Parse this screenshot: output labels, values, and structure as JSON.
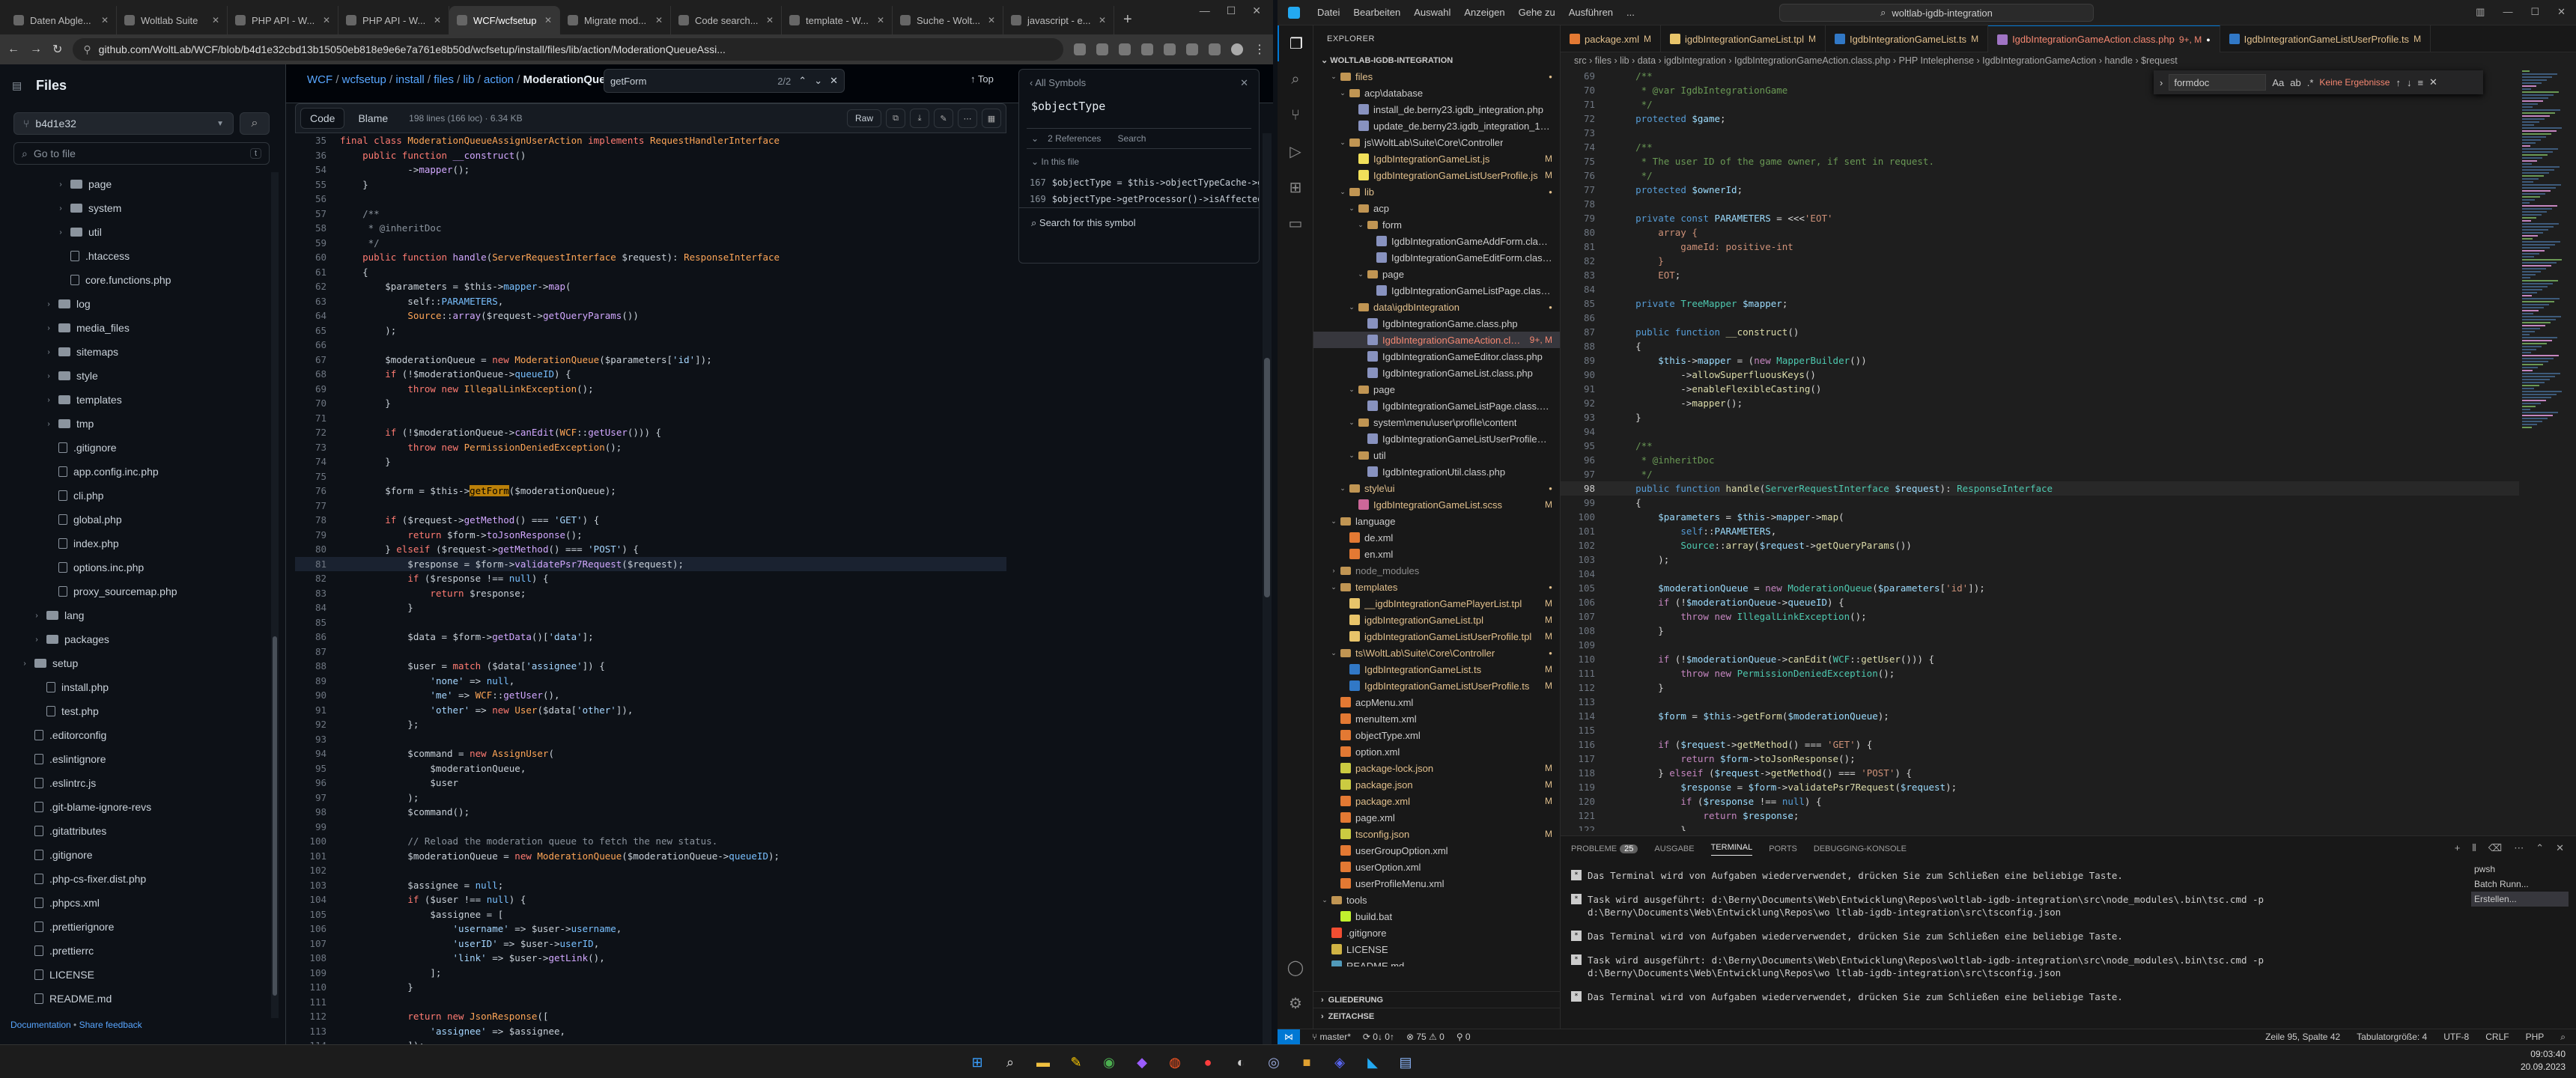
{
  "browser": {
    "tabs": [
      {
        "label": "Daten Abgle..."
      },
      {
        "label": "Woltlab Suite"
      },
      {
        "label": "PHP API - W..."
      },
      {
        "label": "PHP API - W..."
      },
      {
        "label": "WCF/wcfsetup"
      },
      {
        "label": "Migrate mod..."
      },
      {
        "label": "Code search..."
      },
      {
        "label": "template - W..."
      },
      {
        "label": "Suche - Wolt..."
      },
      {
        "label": "javascript - e..."
      }
    ],
    "url": "github.com/WoltLab/WCF/blob/b4d1e32cbd13b15050eb818e9e6e7a761e8b50d/wcfsetup/install/files/lib/action/ModerationQueueAssi..."
  },
  "github": {
    "files_title": "Files",
    "branch": "b4d1e32",
    "goto_placeholder": "Go to file",
    "goto_kbd": "t",
    "tree": [
      {
        "label": "page",
        "type": "folder",
        "depth": 2
      },
      {
        "label": "system",
        "type": "folder",
        "depth": 2
      },
      {
        "label": "util",
        "type": "folder",
        "depth": 2
      },
      {
        "label": ".htaccess",
        "type": "file",
        "depth": 2
      },
      {
        "label": "core.functions.php",
        "type": "file",
        "depth": 2
      },
      {
        "label": "log",
        "type": "folder",
        "depth": 1
      },
      {
        "label": "media_files",
        "type": "folder",
        "depth": 1
      },
      {
        "label": "sitemaps",
        "type": "folder",
        "depth": 1
      },
      {
        "label": "style",
        "type": "folder",
        "depth": 1
      },
      {
        "label": "templates",
        "type": "folder",
        "depth": 1
      },
      {
        "label": "tmp",
        "type": "folder",
        "depth": 1
      },
      {
        "label": ".gitignore",
        "type": "file",
        "depth": 1
      },
      {
        "label": "app.config.inc.php",
        "type": "file",
        "depth": 1
      },
      {
        "label": "cli.php",
        "type": "file",
        "depth": 1
      },
      {
        "label": "global.php",
        "type": "file",
        "depth": 1
      },
      {
        "label": "index.php",
        "type": "file",
        "depth": 1
      },
      {
        "label": "options.inc.php",
        "type": "file",
        "depth": 1
      },
      {
        "label": "proxy_sourcemap.php",
        "type": "file",
        "depth": 1
      },
      {
        "label": "lang",
        "type": "folder",
        "depth": 0
      },
      {
        "label": "packages",
        "type": "folder",
        "depth": 0
      },
      {
        "label": "setup",
        "type": "folder",
        "depth": -1
      },
      {
        "label": "install.php",
        "type": "file",
        "depth": 0
      },
      {
        "label": "test.php",
        "type": "file",
        "depth": 0
      },
      {
        "label": ".editorconfig",
        "type": "file",
        "depth": -1
      },
      {
        "label": ".eslintignore",
        "type": "file",
        "depth": -1
      },
      {
        "label": ".eslintrc.js",
        "type": "file",
        "depth": -1
      },
      {
        "label": ".git-blame-ignore-revs",
        "type": "file",
        "depth": -1
      },
      {
        "label": ".gitattributes",
        "type": "file",
        "depth": -1
      },
      {
        "label": ".gitignore",
        "type": "file",
        "depth": -1
      },
      {
        "label": ".php-cs-fixer.dist.php",
        "type": "file",
        "depth": -1
      },
      {
        "label": ".phpcs.xml",
        "type": "file",
        "depth": -1
      },
      {
        "label": ".prettierignore",
        "type": "file",
        "depth": -1
      },
      {
        "label": ".prettierrc",
        "type": "file",
        "depth": -1
      },
      {
        "label": "LICENSE",
        "type": "file",
        "depth": -1
      },
      {
        "label": "README.md",
        "type": "file",
        "depth": -1
      }
    ],
    "footer_doc": "Documentation",
    "footer_sep": " • ",
    "footer_feedback": "Share feedback",
    "breadcrumb": {
      "parts": [
        "WCF",
        "wcfsetup",
        "install",
        "files",
        "lib",
        "action"
      ],
      "current": "ModerationQueue..."
    },
    "find": {
      "value": "getForm",
      "count": "2/2"
    },
    "top_label": "Top",
    "code_tab": "Code",
    "blame_tab": "Blame",
    "meta": "198 lines (166 loc) · 6.34 KB",
    "raw_label": "Raw",
    "symbols": {
      "header": "All Symbols",
      "name": "$objectType",
      "refs_label": "2 References",
      "refs_search": "Search",
      "in_file": "In this file",
      "refs": [
        {
          "line": "167",
          "text": "$objectType = $this->objectTypeCache->get"
        },
        {
          "line": "169",
          "text": "$objectType->getProcessor()->isAffectedU"
        }
      ],
      "search_symbol": "Search for this symbol"
    }
  },
  "vscode": {
    "menu": [
      "Datei",
      "Bearbeiten",
      "Auswahl",
      "Anzeigen",
      "Gehe zu",
      "Ausführen",
      "..."
    ],
    "search": "woltlab-igdb-integration",
    "explorer_title": "EXPLORER",
    "root": "WOLTLAB-IGDB-INTEGRATION",
    "tree": [
      {
        "label": "files",
        "indent": 1,
        "chev": "v",
        "ic": "folder",
        "state": "",
        "cls": "m"
      },
      {
        "label": "acp\\database",
        "indent": 2,
        "chev": "v",
        "ic": "folder",
        "state": "",
        "cls": ""
      },
      {
        "label": "install_de.berny23.igdb_integration.php",
        "indent": 3,
        "chev": "",
        "ic": "php",
        "state": "",
        "cls": ""
      },
      {
        "label": "update_de.berny23.igdb_integration_1.2.2.php",
        "indent": 3,
        "chev": "",
        "ic": "php",
        "state": "",
        "cls": ""
      },
      {
        "label": "js\\WoltLab\\Suite\\Core\\Controller",
        "indent": 2,
        "chev": "v",
        "ic": "folder",
        "state": "",
        "cls": ""
      },
      {
        "label": "IgdbIntegrationGameList.js",
        "indent": 3,
        "chev": "",
        "ic": "js",
        "state": "M",
        "cls": "m"
      },
      {
        "label": "IgdbIntegrationGameListUserProfile.js",
        "indent": 3,
        "chev": "",
        "ic": "js",
        "state": "M",
        "cls": "m"
      },
      {
        "label": "lib",
        "indent": 2,
        "chev": "v",
        "ic": "folder",
        "state": "",
        "cls": "m"
      },
      {
        "label": "acp",
        "indent": 3,
        "chev": "v",
        "ic": "folder",
        "state": "",
        "cls": ""
      },
      {
        "label": "form",
        "indent": 4,
        "chev": "v",
        "ic": "folder",
        "state": "",
        "cls": ""
      },
      {
        "label": "IgdbIntegrationGameAddForm.class.php",
        "indent": 5,
        "chev": "",
        "ic": "php",
        "state": "",
        "cls": ""
      },
      {
        "label": "IgdbIntegrationGameEditForm.class.php",
        "indent": 5,
        "chev": "",
        "ic": "php",
        "state": "",
        "cls": ""
      },
      {
        "label": "page",
        "indent": 4,
        "chev": "v",
        "ic": "folder",
        "state": "",
        "cls": ""
      },
      {
        "label": "IgdbIntegrationGameListPage.class.php",
        "indent": 5,
        "chev": "",
        "ic": "php",
        "state": "",
        "cls": ""
      },
      {
        "label": "data\\igdbIntegration",
        "indent": 3,
        "chev": "v",
        "ic": "folder",
        "state": "",
        "cls": "m"
      },
      {
        "label": "IgdbIntegrationGame.class.php",
        "indent": 4,
        "chev": "",
        "ic": "php",
        "state": "",
        "cls": ""
      },
      {
        "label": "IgdbIntegrationGameAction.class.php",
        "indent": 4,
        "chev": "",
        "ic": "php",
        "state": "9+, M",
        "cls": "err",
        "sel": true
      },
      {
        "label": "IgdbIntegrationGameEditor.class.php",
        "indent": 4,
        "chev": "",
        "ic": "php",
        "state": "",
        "cls": ""
      },
      {
        "label": "IgdbIntegrationGameList.class.php",
        "indent": 4,
        "chev": "",
        "ic": "php",
        "state": "",
        "cls": ""
      },
      {
        "label": "page",
        "indent": 3,
        "chev": "v",
        "ic": "folder",
        "state": "",
        "cls": ""
      },
      {
        "label": "IgdbIntegrationGameListPage.class.php",
        "indent": 4,
        "chev": "",
        "ic": "php",
        "state": "",
        "cls": ""
      },
      {
        "label": "system\\menu\\user\\profile\\content",
        "indent": 3,
        "chev": "v",
        "ic": "folder",
        "state": "",
        "cls": ""
      },
      {
        "label": "IgdbIntegrationGameListUserProfileMenuC...",
        "indent": 4,
        "chev": "",
        "ic": "php",
        "state": "",
        "cls": ""
      },
      {
        "label": "util",
        "indent": 3,
        "chev": "v",
        "ic": "folder",
        "state": "",
        "cls": ""
      },
      {
        "label": "IgdbIntegrationUtil.class.php",
        "indent": 4,
        "chev": "",
        "ic": "php",
        "state": "",
        "cls": ""
      },
      {
        "label": "style\\ui",
        "indent": 2,
        "chev": "v",
        "ic": "folder",
        "state": "",
        "cls": "m"
      },
      {
        "label": "IgdbIntegrationGameList.scss",
        "indent": 3,
        "chev": "",
        "ic": "scss",
        "state": "M",
        "cls": "m"
      },
      {
        "label": "language",
        "indent": 1,
        "chev": "v",
        "ic": "folder",
        "state": "",
        "cls": ""
      },
      {
        "label": "de.xml",
        "indent": 2,
        "chev": "",
        "ic": "xml",
        "state": "",
        "cls": ""
      },
      {
        "label": "en.xml",
        "indent": 2,
        "chev": "",
        "ic": "xml",
        "state": "",
        "cls": ""
      },
      {
        "label": "node_modules",
        "indent": 1,
        "chev": ">",
        "ic": "folder",
        "state": "",
        "cls": "dim"
      },
      {
        "label": "templates",
        "indent": 1,
        "chev": "v",
        "ic": "folder",
        "state": "",
        "cls": "m"
      },
      {
        "label": "__igdbIntegrationGamePlayerList.tpl",
        "indent": 2,
        "chev": "",
        "ic": "tpl",
        "state": "M",
        "cls": "m"
      },
      {
        "label": "igdbIntegrationGameList.tpl",
        "indent": 2,
        "chev": "",
        "ic": "tpl",
        "state": "M",
        "cls": "m"
      },
      {
        "label": "igdbIntegrationGameListUserProfile.tpl",
        "indent": 2,
        "chev": "",
        "ic": "tpl",
        "state": "M",
        "cls": "m"
      },
      {
        "label": "ts\\WoltLab\\Suite\\Core\\Controller",
        "indent": 1,
        "chev": "v",
        "ic": "folder",
        "state": "",
        "cls": "m"
      },
      {
        "label": "IgdbIntegrationGameList.ts",
        "indent": 2,
        "chev": "",
        "ic": "ts",
        "state": "M",
        "cls": "m"
      },
      {
        "label": "IgdbIntegrationGameListUserProfile.ts",
        "indent": 2,
        "chev": "",
        "ic": "ts",
        "state": "M",
        "cls": "m"
      },
      {
        "label": "acpMenu.xml",
        "indent": 1,
        "chev": "",
        "ic": "xml",
        "state": "",
        "cls": ""
      },
      {
        "label": "menuItem.xml",
        "indent": 1,
        "chev": "",
        "ic": "xml",
        "state": "",
        "cls": ""
      },
      {
        "label": "objectType.xml",
        "indent": 1,
        "chev": "",
        "ic": "xml",
        "state": "",
        "cls": ""
      },
      {
        "label": "option.xml",
        "indent": 1,
        "chev": "",
        "ic": "xml",
        "state": "",
        "cls": ""
      },
      {
        "label": "package-lock.json",
        "indent": 1,
        "chev": "",
        "ic": "json",
        "state": "M",
        "cls": "m"
      },
      {
        "label": "package.json",
        "indent": 1,
        "chev": "",
        "ic": "json",
        "state": "M",
        "cls": "m"
      },
      {
        "label": "package.xml",
        "indent": 1,
        "chev": "",
        "ic": "xml",
        "state": "M",
        "cls": "m"
      },
      {
        "label": "page.xml",
        "indent": 1,
        "chev": "",
        "ic": "xml",
        "state": "",
        "cls": ""
      },
      {
        "label": "tsconfig.json",
        "indent": 1,
        "chev": "",
        "ic": "json",
        "state": "M",
        "cls": "m"
      },
      {
        "label": "userGroupOption.xml",
        "indent": 1,
        "chev": "",
        "ic": "xml",
        "state": "",
        "cls": ""
      },
      {
        "label": "userOption.xml",
        "indent": 1,
        "chev": "",
        "ic": "xml",
        "state": "",
        "cls": ""
      },
      {
        "label": "userProfileMenu.xml",
        "indent": 1,
        "chev": "",
        "ic": "xml",
        "state": "",
        "cls": ""
      },
      {
        "label": "tools",
        "indent": 0,
        "chev": "v",
        "ic": "folder",
        "state": "",
        "cls": ""
      },
      {
        "label": "build.bat",
        "indent": 1,
        "chev": "",
        "ic": "bat",
        "state": "",
        "cls": ""
      },
      {
        "label": ".gitignore",
        "indent": 0,
        "chev": "",
        "ic": "git",
        "state": "",
        "cls": ""
      },
      {
        "label": "LICENSE",
        "indent": 0,
        "chev": "",
        "ic": "lic",
        "state": "",
        "cls": ""
      },
      {
        "label": "README.md",
        "indent": 0,
        "chev": "",
        "ic": "md",
        "state": "",
        "cls": ""
      }
    ],
    "sections": [
      "GLIEDERUNG",
      "ZEITACHSE"
    ],
    "tabs": [
      {
        "label": "package.xml",
        "state": "M",
        "active": false
      },
      {
        "label": "igdbIntegrationGameList.tpl",
        "state": "M",
        "active": false
      },
      {
        "label": "IgdbIntegrationGameList.ts",
        "state": "M",
        "active": false
      },
      {
        "label": "IgdbIntegrationGameAction.class.php",
        "state": "9+, M",
        "active": true
      },
      {
        "label": "IgdbIntegrationGameListUserProfile.ts",
        "state": "M",
        "active": false
      }
    ],
    "breadcrumb": "src › files › lib › data › igdbIntegration › IgdbIntegrationGameAction.class.php › PHP Intelephense › IgdbIntegrationGameAction › handle › $request",
    "find": {
      "value": "formdoc",
      "result": "Keine Ergebnisse"
    },
    "panel_tabs": [
      {
        "label": "PROBLEME",
        "badge": "25"
      },
      {
        "label": "AUSGABE"
      },
      {
        "label": "TERMINAL",
        "active": true
      },
      {
        "label": "PORTS"
      },
      {
        "label": "DEBUGGING-KONSOLE"
      }
    ],
    "terminal": [
      "Das Terminal wird von Aufgaben wiederverwendet, drücken Sie zum Schließen eine beliebige Taste.",
      "Task wird ausgeführt: d:\\Berny\\Documents\\Web\\Entwicklung\\Repos\\woltlab-igdb-integration\\src\\node_modules\\.bin\\tsc.cmd -p d:\\Berny\\Documents\\Web\\Entwicklung\\Repos\\wo ltlab-igdb-integration\\src\\tsconfig.json",
      "Das Terminal wird von Aufgaben wiederverwendet, drücken Sie zum Schließen eine beliebige Taste.",
      "Task wird ausgeführt: d:\\Berny\\Documents\\Web\\Entwicklung\\Repos\\woltlab-igdb-integration\\src\\node_modules\\.bin\\tsc.cmd -p d:\\Berny\\Documents\\Web\\Entwicklung\\Repos\\wo ltlab-igdb-integration\\src\\tsconfig.json",
      "Das Terminal wird von Aufgaben wiederverwendet, drücken Sie zum Schließen eine beliebige Taste."
    ],
    "terminal_list": [
      "pwsh",
      "Batch Runn...",
      "Erstellen..."
    ],
    "status": {
      "branch": "master*",
      "sync": "⟳ 0↓ 0↑",
      "problems": "⊗ 75 ⚠ 0",
      "ports": "⚲ 0",
      "right": [
        "Zeile 95, Spalte 42",
        "Tabulatorgröße: 4",
        "UTF-8",
        "CRLF",
        "PHP",
        "⌕"
      ]
    }
  },
  "taskbar": {
    "time": "09:03:40",
    "date": "20.09.2023"
  }
}
